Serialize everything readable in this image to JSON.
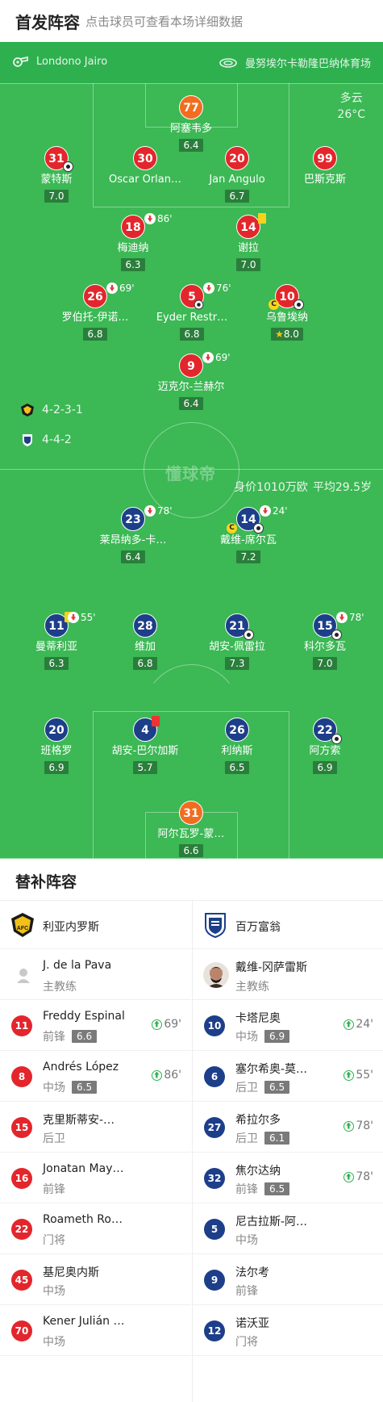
{
  "header": {
    "title": "首发阵容",
    "subtitle": "点击球员可查看本场详细数据"
  },
  "info": {
    "referee": "Londono Jairo",
    "stadium": "曼努埃尔卡勒隆巴纳体育场"
  },
  "weather": {
    "condition": "多云",
    "temp": "26°C"
  },
  "watermark": "懂球帝",
  "home": {
    "formation": "4-2-3-1",
    "color": "#e3262c",
    "players": [
      {
        "num": "77",
        "name": "阿塞韦多",
        "rating": "6.4",
        "gk": true
      },
      {
        "num": "31",
        "name": "蒙特斯",
        "rating": "7.0"
      },
      {
        "num": "30",
        "name": "Oscar Orlan…",
        "rating": ""
      },
      {
        "num": "20",
        "name": "Jan Angulo",
        "rating": "6.7"
      },
      {
        "num": "99",
        "name": "巴斯克斯",
        "rating": ""
      },
      {
        "num": "18",
        "name": "梅迪纳",
        "rating": "6.3",
        "sub_min": "86'"
      },
      {
        "num": "14",
        "name": "谢拉",
        "rating": "7.0"
      },
      {
        "num": "26",
        "name": "罗伯托-伊诺…",
        "rating": "6.8",
        "sub_min": "69'"
      },
      {
        "num": "5",
        "name": "Eyder Restr…",
        "rating": "6.8",
        "sub_min": "76'"
      },
      {
        "num": "10",
        "name": "乌鲁埃纳",
        "rating": "8.0",
        "captain": "C"
      },
      {
        "num": "9",
        "name": "迈克尔-兰赫尔",
        "rating": "6.4",
        "sub_min": "69'"
      }
    ]
  },
  "away": {
    "formation": "4-4-2",
    "color": "#1d3f8a",
    "value_text": "身价1010万欧",
    "avg_age": "平均29.5岁",
    "players": [
      {
        "num": "23",
        "name": "莱昂纳多-卡…",
        "rating": "6.4",
        "sub_min": "78'"
      },
      {
        "num": "14",
        "name": "戴维-席尔瓦",
        "rating": "7.2",
        "sub_min": "24'",
        "captain": "C"
      },
      {
        "num": "11",
        "name": "曼蒂利亚",
        "rating": "6.3",
        "sub_min": "55'"
      },
      {
        "num": "28",
        "name": "维加",
        "rating": "6.8"
      },
      {
        "num": "21",
        "name": "胡安-佩雷拉",
        "rating": "7.3"
      },
      {
        "num": "15",
        "name": "科尔多瓦",
        "rating": "7.0",
        "sub_min": "78'"
      },
      {
        "num": "20",
        "name": "班格罗",
        "rating": "6.9"
      },
      {
        "num": "4",
        "name": "胡安-巴尔加斯",
        "rating": "5.7"
      },
      {
        "num": "26",
        "name": "利纳斯",
        "rating": "6.5"
      },
      {
        "num": "22",
        "name": "阿方索",
        "rating": "6.9"
      },
      {
        "num": "31",
        "name": "阿尔瓦罗-蒙…",
        "rating": "6.6",
        "gk": true
      }
    ]
  },
  "subs": {
    "title": "替补阵容",
    "home": {
      "team": "利亚内罗斯",
      "coach": {
        "name": "J. de la Pava",
        "role": "主教练"
      },
      "players": [
        {
          "num": "11",
          "name": "Freddy Espinal",
          "pos": "前锋",
          "rating": "6.6",
          "in": "69'"
        },
        {
          "num": "8",
          "name": "Andrés López",
          "pos": "中场",
          "rating": "6.5",
          "in": "86'"
        },
        {
          "num": "15",
          "name": "克里斯蒂安-…",
          "pos": "后卫",
          "rating": "",
          "in": ""
        },
        {
          "num": "16",
          "name": "Jonatan May…",
          "pos": "前锋",
          "rating": "",
          "in": ""
        },
        {
          "num": "22",
          "name": "Roameth Ro…",
          "pos": "门将",
          "rating": "",
          "in": ""
        },
        {
          "num": "45",
          "name": "基尼奥内斯",
          "pos": "中场",
          "rating": "",
          "in": ""
        },
        {
          "num": "70",
          "name": "Kener Julián …",
          "pos": "中场",
          "rating": "",
          "in": ""
        }
      ]
    },
    "away": {
      "team": "百万富翁",
      "coach": {
        "name": "戴维-冈萨雷斯",
        "role": "主教练"
      },
      "players": [
        {
          "num": "10",
          "name": "卡塔尼奥",
          "pos": "中场",
          "rating": "6.9",
          "in": "24'"
        },
        {
          "num": "6",
          "name": "塞尔希奥-莫…",
          "pos": "后卫",
          "rating": "6.5",
          "in": "55'"
        },
        {
          "num": "27",
          "name": "希拉尔多",
          "pos": "后卫",
          "rating": "6.1",
          "in": "78'"
        },
        {
          "num": "32",
          "name": "焦尔达纳",
          "pos": "前锋",
          "rating": "6.5",
          "in": "78'"
        },
        {
          "num": "5",
          "name": "尼古拉斯-阿…",
          "pos": "中场",
          "rating": "",
          "in": ""
        },
        {
          "num": "9",
          "name": "法尔考",
          "pos": "前锋",
          "rating": "",
          "in": ""
        },
        {
          "num": "12",
          "name": "诺沃亚",
          "pos": "门将",
          "rating": "",
          "in": ""
        }
      ]
    }
  }
}
